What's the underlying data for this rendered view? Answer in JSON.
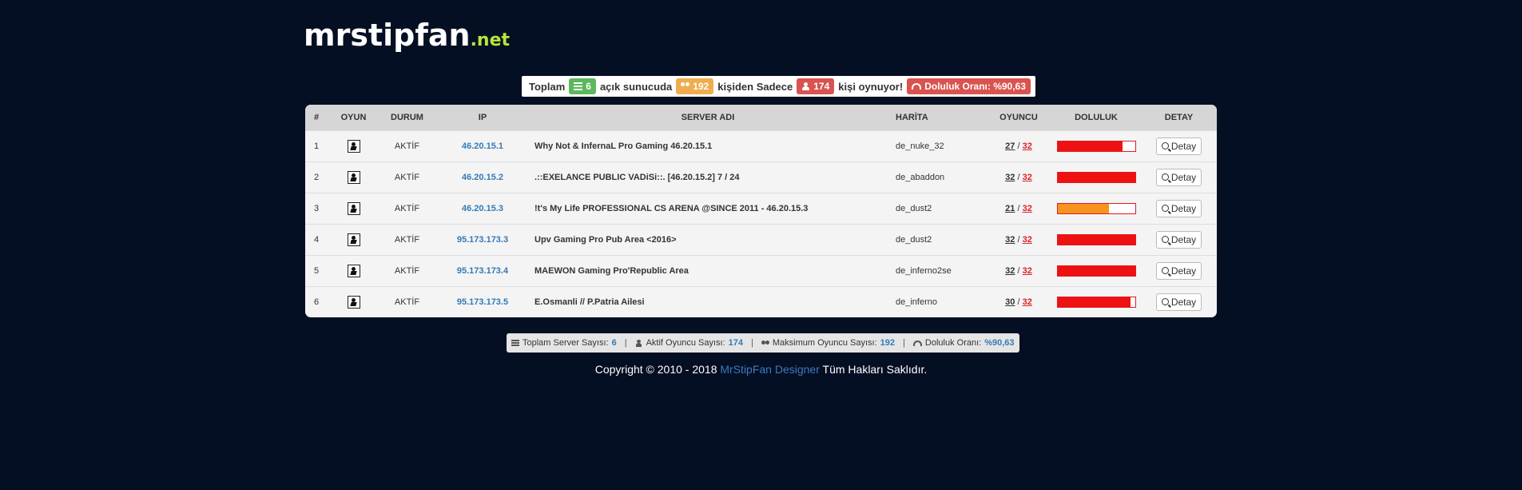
{
  "logo": {
    "name": "mrstipfan",
    "tld": ".net"
  },
  "summary": {
    "t1": "Toplam",
    "servers": "6",
    "t2": "açık sunucuda",
    "max_players": "192",
    "t3": "kişiden Sadece",
    "active_players": "174",
    "t4": "kişi oynuyor!",
    "fill_label": "Doluluk Oranı: %90,63"
  },
  "table": {
    "headers": {
      "num": "#",
      "game": "OYUN",
      "status": "DURUM",
      "ip": "IP",
      "name": "SERVER ADI",
      "map": "HARİTA",
      "players": "OYUNCU",
      "fill": "DOLULUK",
      "detail": "DETAY"
    },
    "rows": [
      {
        "num": "1",
        "status": "AKTİF",
        "ip": "46.20.15.1",
        "name": "Why Not & InfernaL Pro Gaming 46.20.15.1",
        "map": "de_nuke_32",
        "players": "27",
        "max": "32",
        "fill": 0.84,
        "fill_color": "#ee1111",
        "detail": "Detay"
      },
      {
        "num": "2",
        "status": "AKTİF",
        "ip": "46.20.15.2",
        "name": ".::EXELANCE PUBLIC VADiSi::. [46.20.15.2] 7 / 24",
        "map": "de_abaddon",
        "players": "32",
        "max": "32",
        "fill": 1.0,
        "fill_color": "#ee1111",
        "detail": "Detay"
      },
      {
        "num": "3",
        "status": "AKTİF",
        "ip": "46.20.15.3",
        "name": "!t's My Life PROFESSIONAL CS ARENA @SINCE 2011 - 46.20.15.3",
        "map": "de_dust2",
        "players": "21",
        "max": "32",
        "fill": 0.66,
        "fill_color": "#f7941d",
        "detail": "Detay"
      },
      {
        "num": "4",
        "status": "AKTİF",
        "ip": "95.173.173.3",
        "name": "Upv Gaming Pro Pub Area <2016>",
        "map": "de_dust2",
        "players": "32",
        "max": "32",
        "fill": 1.0,
        "fill_color": "#ee1111",
        "detail": "Detay"
      },
      {
        "num": "5",
        "status": "AKTİF",
        "ip": "95.173.173.4",
        "name": "MAEWON Gaming Pro'Republic Area",
        "map": "de_inferno2se",
        "players": "32",
        "max": "32",
        "fill": 1.0,
        "fill_color": "#ee1111",
        "detail": "Detay"
      },
      {
        "num": "6",
        "status": "AKTİF",
        "ip": "95.173.173.5",
        "name": "E.Osmanli // P.Patria Ailesi",
        "map": "de_inferno",
        "players": "30",
        "max": "32",
        "fill": 0.94,
        "fill_color": "#ee1111",
        "detail": "Detay"
      }
    ]
  },
  "stats": {
    "servers_label": "Toplam Server Sayısı:",
    "servers": "6",
    "active_label": "Aktif Oyuncu Sayısı:",
    "active": "174",
    "max_label": "Maksimum Oyuncu Sayısı:",
    "max": "192",
    "fill_label": "Doluluk Oranı:",
    "fill": "%90,63",
    "sep": "|"
  },
  "footer": {
    "prefix": "Copyright © 2010 - 2018",
    "link": "MrStipFan Designer",
    "suffix": "Tüm Hakları Saklıdır."
  }
}
